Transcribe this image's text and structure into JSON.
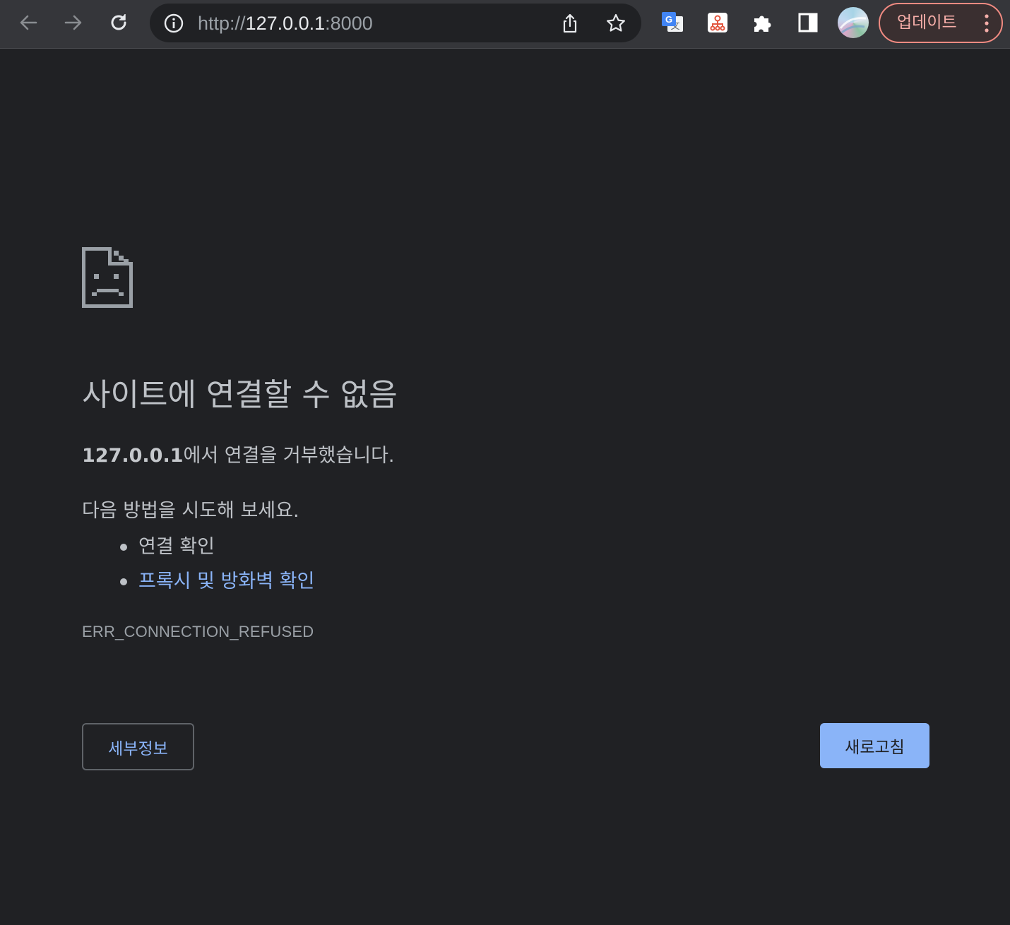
{
  "toolbar": {
    "back_icon": "arrow-left-icon",
    "forward_icon": "arrow-right-icon",
    "reload_icon": "reload-icon",
    "url": {
      "scheme": "http://",
      "host": "127.0.0.1",
      "port": ":8000"
    },
    "extensions": [
      "google-translate-icon",
      "sitemap-extension-icon",
      "puzzle-icon",
      "side-panel-icon"
    ],
    "update_label": "업데이트"
  },
  "error": {
    "title": "사이트에 연결할 수 없음",
    "host_bold": "127.0.0.1",
    "description_rest": "에서 연결을 거부했습니다.",
    "try_label": "다음 방법을 시도해 보세요.",
    "suggestions": [
      {
        "text": "연결 확인",
        "link": false
      },
      {
        "text": "프록시 및 방화벽 확인",
        "link": true
      }
    ],
    "code": "ERR_CONNECTION_REFUSED"
  },
  "buttons": {
    "details": "세부정보",
    "reload": "새로고침"
  },
  "colors": {
    "background": "#202124",
    "toolbar": "#35363a",
    "link": "#8ab4f8",
    "update_accent": "#f28b82"
  }
}
